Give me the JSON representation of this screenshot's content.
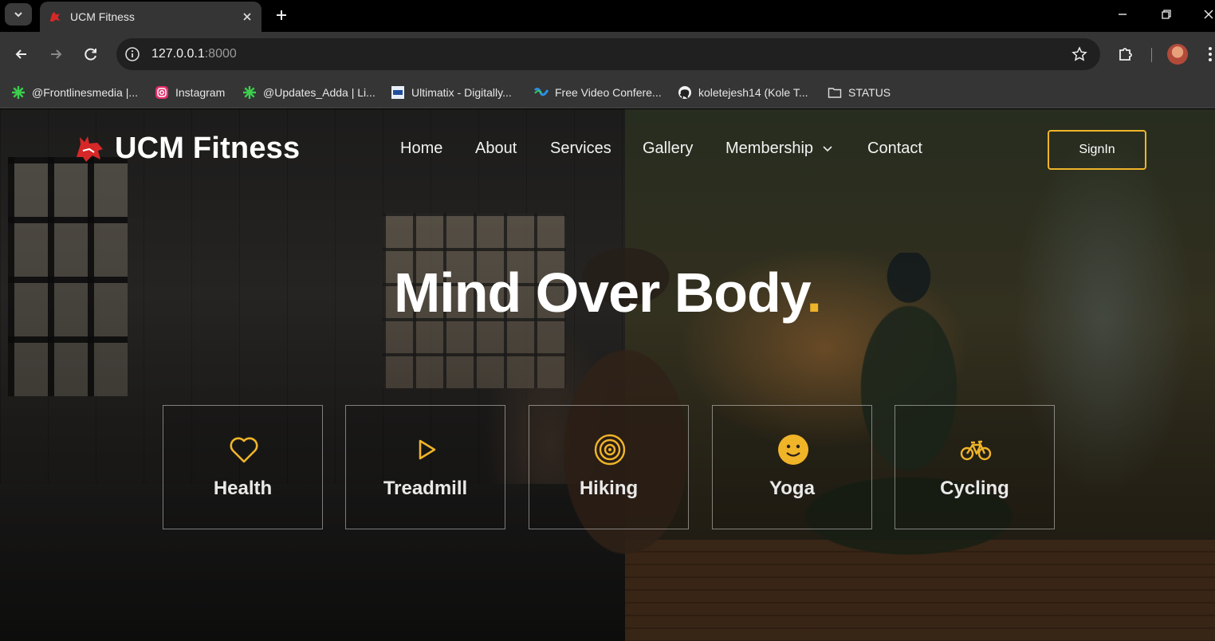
{
  "browser": {
    "tab_title": "UCM Fitness",
    "url_host": "127.0.0.1",
    "url_port": ":8000",
    "bookmarks": [
      {
        "label": "@Frontlinesmedia |...",
        "icon": "green-asterisk-icon"
      },
      {
        "label": "Instagram",
        "icon": "instagram-icon"
      },
      {
        "label": "@Updates_Adda | Li...",
        "icon": "green-asterisk-icon"
      },
      {
        "label": "Ultimatix - Digitally...",
        "icon": "tcs-icon"
      },
      {
        "label": "Free Video Confere...",
        "icon": "webex-icon"
      },
      {
        "label": "koletejesh14 (Kole T...",
        "icon": "github-icon"
      },
      {
        "label": "STATUS",
        "icon": "folder-icon"
      }
    ]
  },
  "site": {
    "brand": "UCM Fitness",
    "nav": {
      "home": "Home",
      "about": "About",
      "services": "Services",
      "gallery": "Gallery",
      "membership": "Membership",
      "contact": "Contact"
    },
    "signin": "SignIn",
    "accent": "#f0b429"
  },
  "hero": {
    "title": "Mind Over Body",
    "title_dot": ".",
    "cards": [
      {
        "label": "Health",
        "icon": "heart-icon"
      },
      {
        "label": "Treadmill",
        "icon": "play-icon"
      },
      {
        "label": "Hiking",
        "icon": "target-icon"
      },
      {
        "label": "Yoga",
        "icon": "smiley-icon"
      },
      {
        "label": "Cycling",
        "icon": "bicycle-icon"
      }
    ]
  }
}
